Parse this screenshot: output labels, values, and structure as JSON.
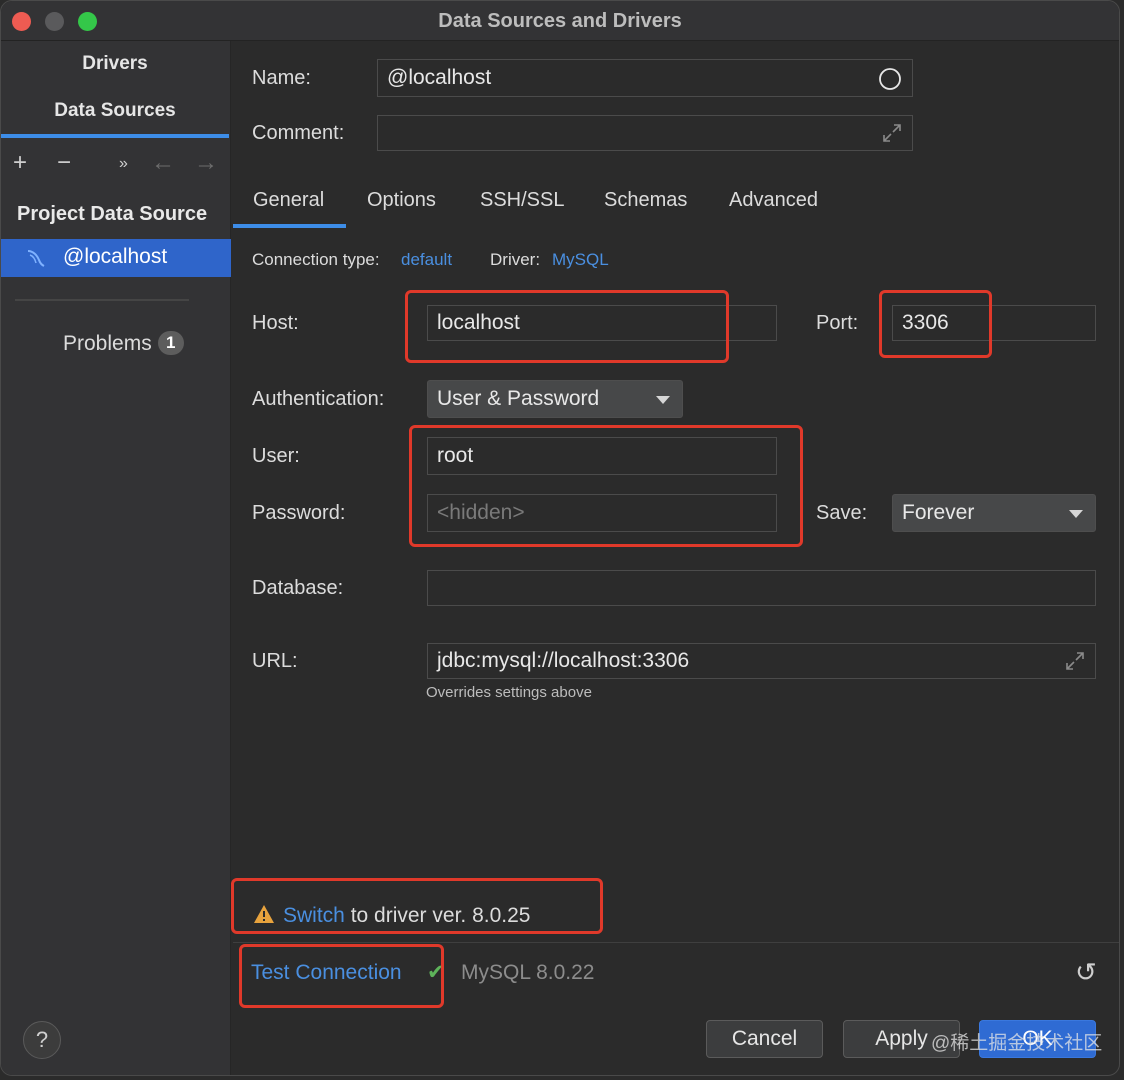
{
  "window": {
    "title": "Data Sources and Drivers"
  },
  "sidebar": {
    "tabs": [
      "Drivers",
      "Data Sources"
    ],
    "toolbar": {
      "add": "+",
      "remove": "−",
      "more": "»",
      "back": "←",
      "forward": "→"
    },
    "section_header": "Project Data Source",
    "selected_item": "@localhost",
    "problems_label": "Problems",
    "problems_count": "1"
  },
  "form": {
    "name_label": "Name:",
    "name_value": "@localhost",
    "comment_label": "Comment:",
    "comment_value": "",
    "tabs": [
      "General",
      "Options",
      "SSH/SSL",
      "Schemas",
      "Advanced"
    ],
    "connection_type_label": "Connection type:",
    "connection_type_value": "default",
    "driver_label": "Driver:",
    "driver_value": "MySQL",
    "host_label": "Host:",
    "host_value": "localhost",
    "port_label": "Port:",
    "port_value": "3306",
    "auth_label": "Authentication:",
    "auth_value": "User & Password",
    "user_label": "User:",
    "user_value": "root",
    "password_label": "Password:",
    "password_placeholder": "<hidden>",
    "save_label": "Save:",
    "save_value": "Forever",
    "database_label": "Database:",
    "database_value": "",
    "url_label": "URL:",
    "url_value": "jdbc:mysql://localhost:3306",
    "url_hint": "Overrides settings above"
  },
  "footer": {
    "warning_link": "Switch",
    "warning_text": " to driver ver. 8.0.25",
    "test_connection": "Test Connection",
    "db_version": "MySQL 8.0.22",
    "help": "?",
    "cancel": "Cancel",
    "apply": "Apply",
    "ok": "OK",
    "watermark": "@稀土掘金技术社区"
  },
  "colors": {
    "accent": "#3d8de8",
    "link": "#4a8fe0",
    "selection": "#2f65ca",
    "annotation_red": "#e0392a",
    "success": "#5eb35a",
    "warning": "#e8a33d"
  },
  "icons": [
    "circle-icon",
    "expand-icon",
    "mysql-dolphin-icon",
    "warning-icon",
    "check-icon",
    "revert-icon",
    "help-icon",
    "chevron-down-icon"
  ]
}
